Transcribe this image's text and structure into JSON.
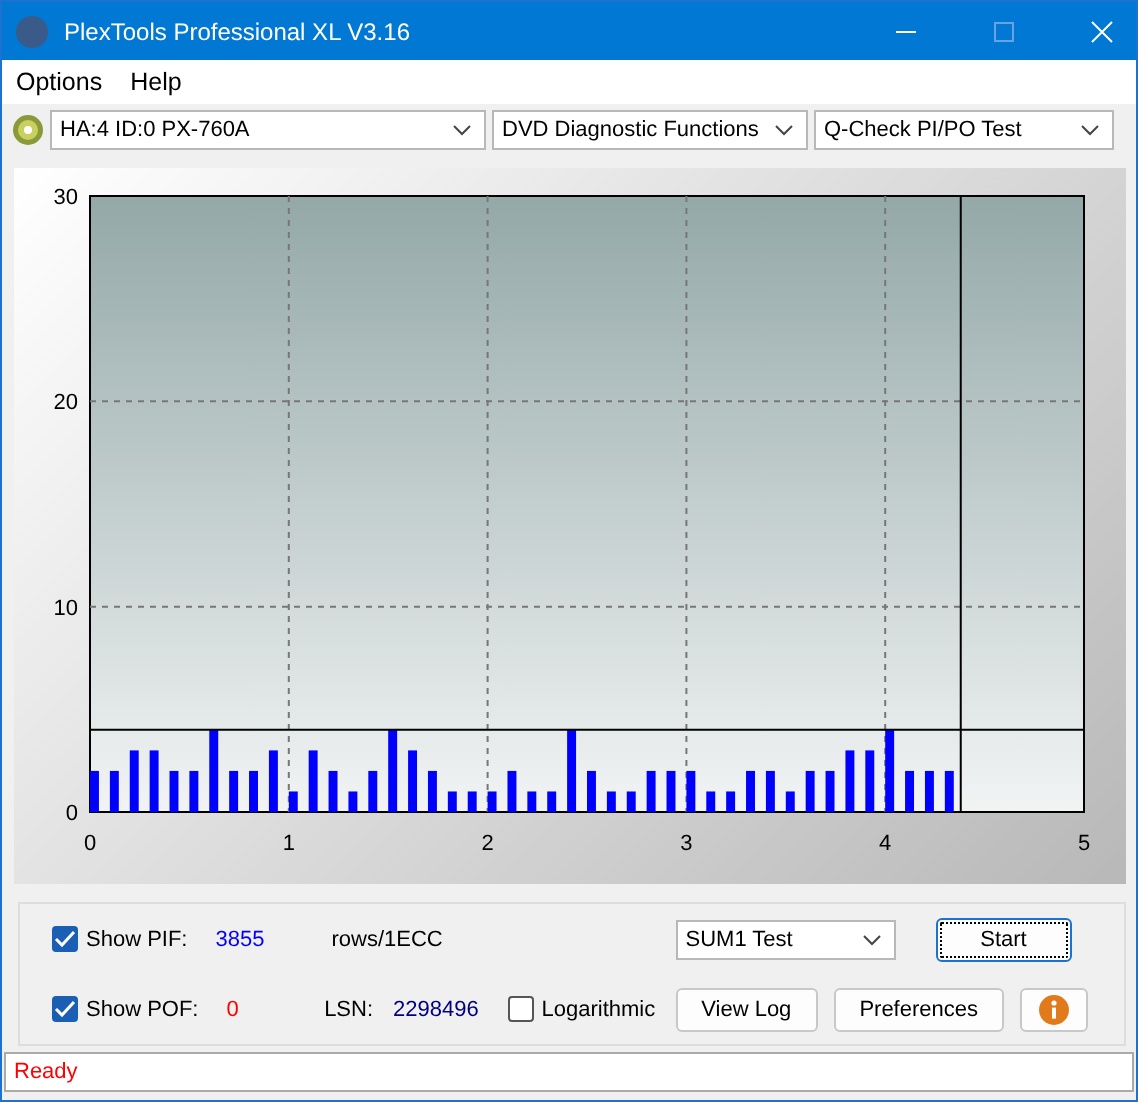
{
  "window": {
    "title": "PlexTools Professional XL V3.16"
  },
  "menu": [
    {
      "label": "Options"
    },
    {
      "label": "Help"
    }
  ],
  "toolbar": {
    "drive": "HA:4 ID:0  PX-760A",
    "function": "DVD Diagnostic Functions",
    "test": "Q-Check PI/PO Test"
  },
  "chart": {
    "chart_data": {
      "type": "bar",
      "grid": true,
      "xlim": [
        0,
        5
      ],
      "ylim": [
        0,
        30
      ],
      "xticks": [
        0,
        1,
        2,
        3,
        4,
        5
      ],
      "yticks": [
        0,
        10,
        20,
        30
      ],
      "x": [
        0,
        0.1,
        0.2,
        0.3,
        0.4,
        0.5,
        0.6,
        0.7,
        0.8,
        0.9,
        1,
        1.1,
        1.2,
        1.3,
        1.4,
        1.5,
        1.6,
        1.7,
        1.8,
        1.9,
        2,
        2.1,
        2.2,
        2.3,
        2.4,
        2.5,
        2.6,
        2.7,
        2.8,
        2.9,
        3,
        3.1,
        3.2,
        3.3,
        3.4,
        3.5,
        3.6,
        3.7,
        3.8,
        3.9,
        4,
        4.1,
        4.2,
        4.3
      ],
      "series": [
        {
          "color": "#0000ff",
          "values": [
            2,
            2,
            3,
            3,
            2,
            2,
            4,
            2,
            2,
            3,
            1,
            3,
            2,
            1,
            2,
            4,
            3,
            2,
            1,
            1,
            1,
            2,
            1,
            1,
            4,
            2,
            1,
            1,
            2,
            2,
            2,
            1,
            1,
            2,
            2,
            1,
            2,
            2,
            3,
            3,
            4,
            2,
            2,
            2
          ]
        }
      ],
      "ref_lines": [
        {
          "axis": "y",
          "value": 4
        },
        {
          "axis": "x",
          "value": 4.38
        }
      ]
    }
  },
  "controls": {
    "show_pif": {
      "label": "Show PIF:",
      "checked": true,
      "value": "3855",
      "unit": "rows/1ECC"
    },
    "show_pof": {
      "label": "Show POF:",
      "checked": true,
      "value": "0"
    },
    "lsn_label": "LSN:",
    "lsn_value": "2298496",
    "logarithmic": {
      "label": "Logarithmic",
      "checked": false
    },
    "test_select": "SUM1 Test",
    "buttons": [
      {
        "label": "Start"
      },
      {
        "label": "View Log"
      },
      {
        "label": "Preferences"
      }
    ]
  },
  "status_bar": "Ready"
}
